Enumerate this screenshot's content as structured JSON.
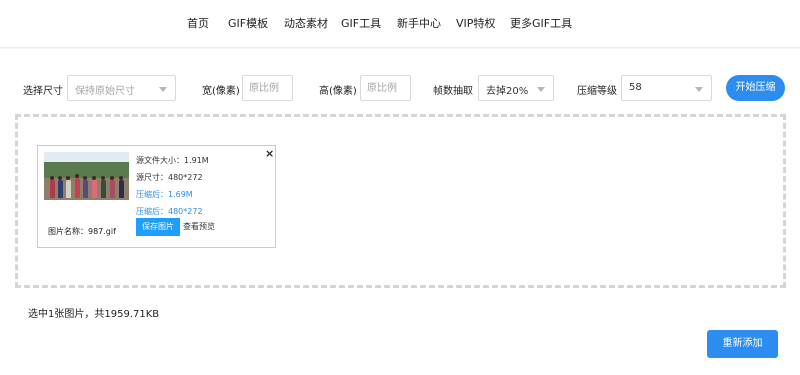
{
  "nav": {
    "items": [
      "首页",
      "GIF模板",
      "动态素材",
      "GIF工具",
      "新手中心",
      "VIP特权",
      "更多GIF工具"
    ]
  },
  "options": {
    "size_label": "选择尺寸",
    "size_select": "保持原始尺寸",
    "width_label": "宽(像素)",
    "width_placeholder": "原比例",
    "height_label": "高(像素)",
    "height_placeholder": "原比例",
    "frame_label": "帧数抽取",
    "frame_select": "去掉20%",
    "level_label": "压缩等级",
    "level_select": "58",
    "start_button": "开始压缩"
  },
  "card": {
    "source_size": "源文件大小：1.91M",
    "source_dims": "源尺寸：480*272",
    "compressed_size": "压缩后：1.69M",
    "compressed_dims": "压缩后：480*272",
    "filename": "图片名称：987.gif",
    "save_button": "保存图片",
    "preview_link": "查看预览",
    "close": "×"
  },
  "summary": "选中1张图片，共1959.71KB",
  "readd_button": "重新添加",
  "colors": {
    "accent": "#2d8cf0",
    "save_button": "#1e9fff",
    "card_border": "#a9d4f4"
  }
}
